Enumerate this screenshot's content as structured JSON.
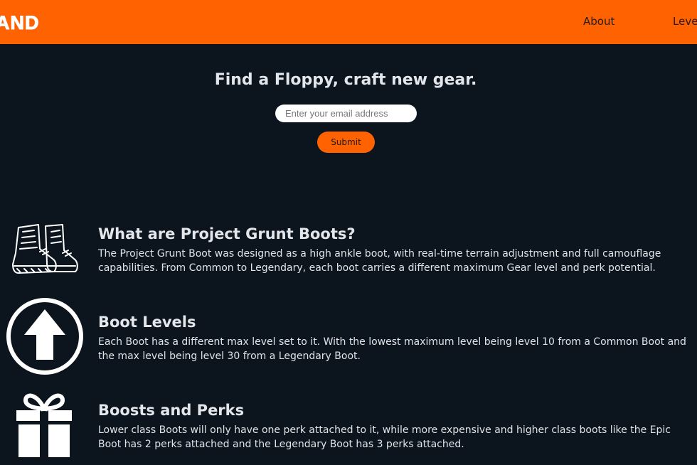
{
  "header": {
    "logo_text": "AND",
    "nav": [
      "About",
      "Levels"
    ]
  },
  "hero": {
    "title": "Find a Floppy, craft new gear.",
    "email_placeholder": "Enter your email address",
    "email_value": "",
    "submit_label": "Submit"
  },
  "features": [
    {
      "icon": "boots-icon",
      "title": "What are Project Grunt Boots?",
      "text": "The Project Grunt Boot was designed as a high ankle boot, with real-time terrain adjustment and full camouflage capabilities. From Common to Legendary, each boot carries a different maximum Gear level and perk potential."
    },
    {
      "icon": "arrow-up-circle-icon",
      "title": "Boot Levels",
      "text": "Each Boot has a different max level set to it. With the lowest maximum level being level 10 from a Common Boot and the max level being level 30 from a Legendary Boot."
    },
    {
      "icon": "gift-icon",
      "title": "Boosts and Perks",
      "text": "Lower class Boots will only have one perk attached to it, while more expensive and higher class boots like the Epic Boot has 2 perks attached and the Legendary Boot has 3 perks attached."
    }
  ],
  "colors": {
    "accent": "#ff6200",
    "background": "#0c141d",
    "text": "#e0e4e8"
  }
}
